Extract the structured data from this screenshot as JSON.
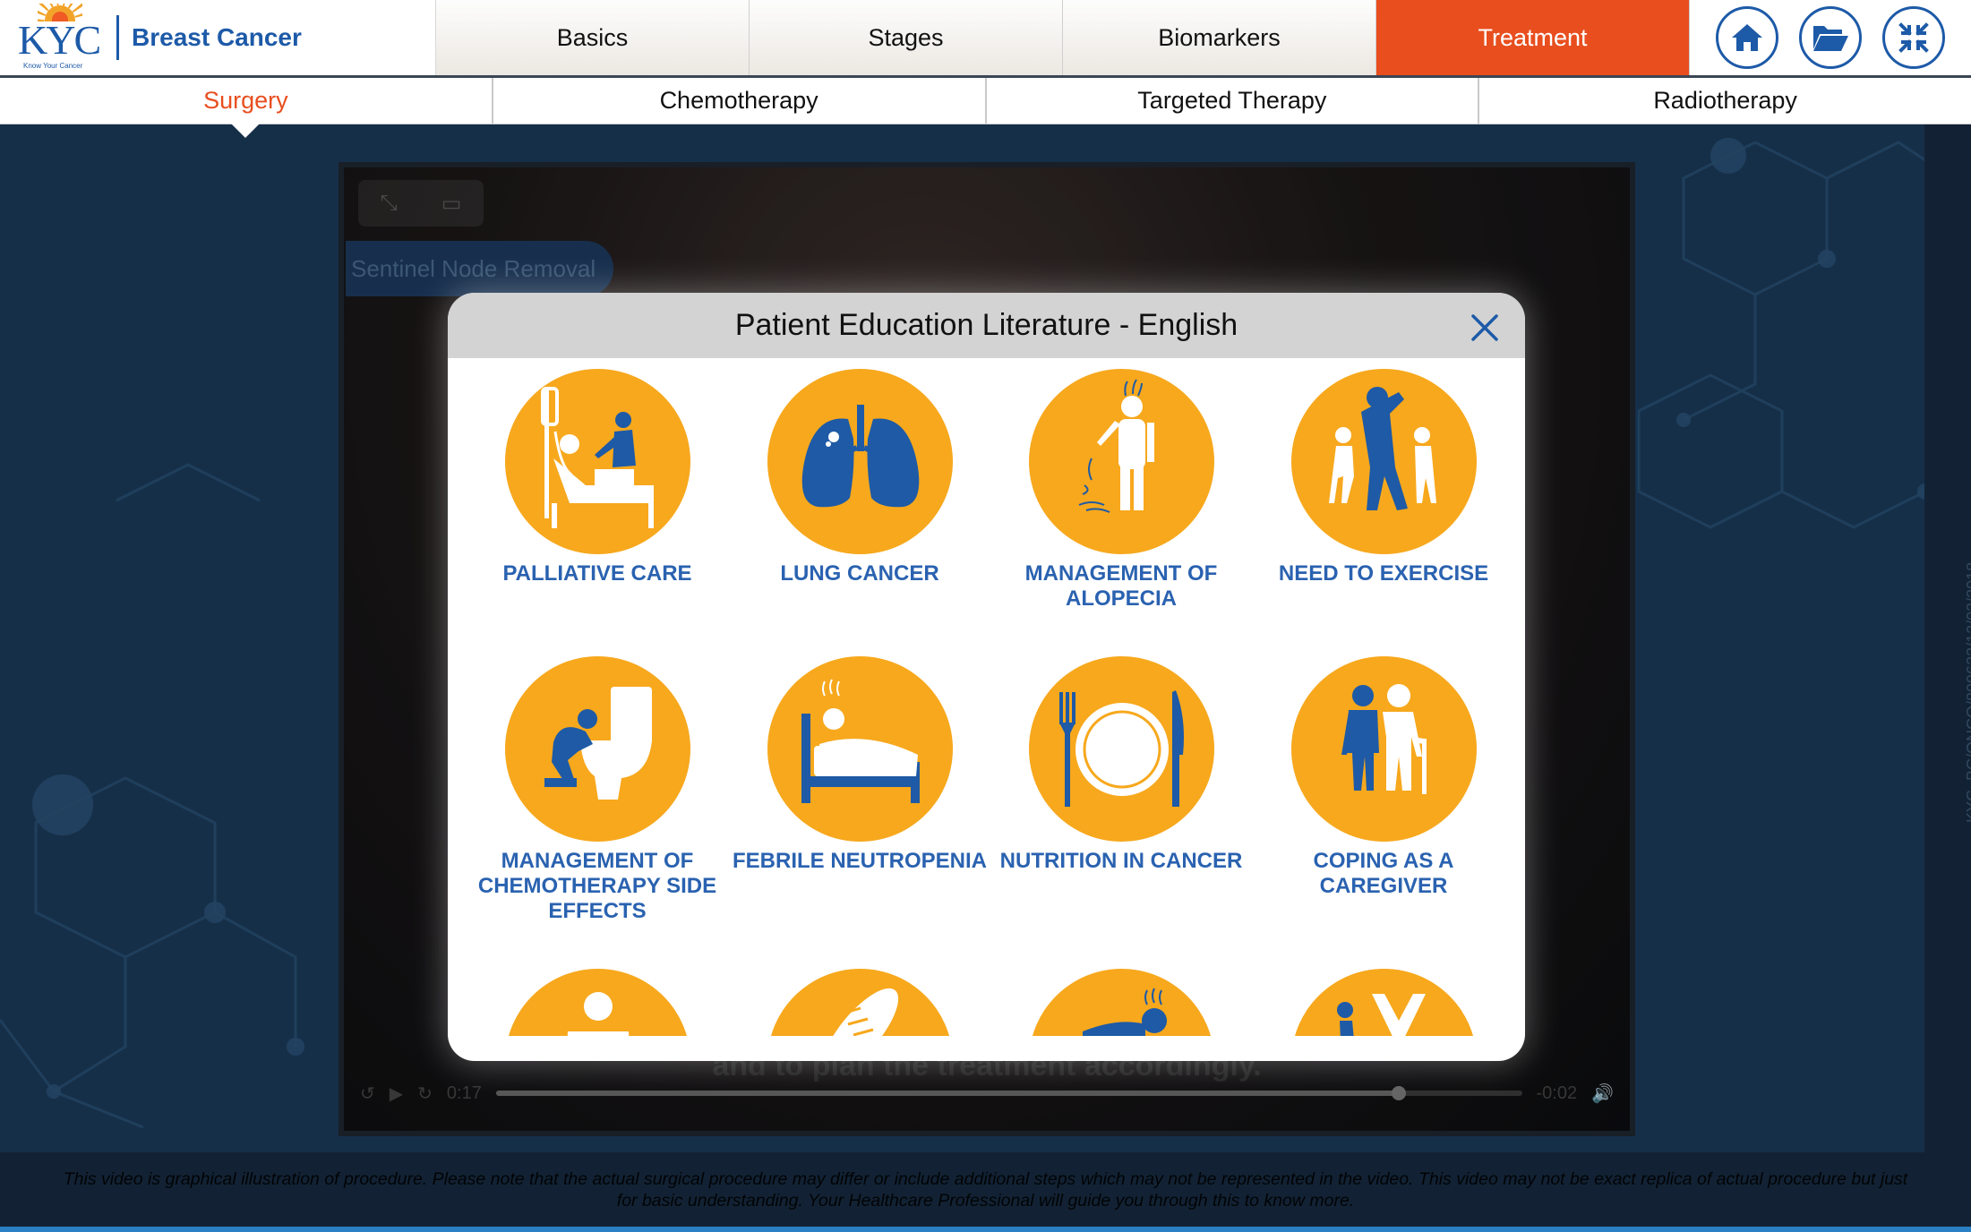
{
  "app": {
    "logo_text": "KYC",
    "logo_tagline": "Know Your Cancer",
    "title": "Breast Cancer"
  },
  "main_tabs": [
    {
      "label": "Basics",
      "active": false
    },
    {
      "label": "Stages",
      "active": false
    },
    {
      "label": "Biomarkers",
      "active": false
    },
    {
      "label": "Treatment",
      "active": true
    }
  ],
  "header_icons": [
    "home-icon",
    "folder-open-icon",
    "collapse-icon"
  ],
  "sub_tabs": [
    {
      "label": "Surgery",
      "active": true
    },
    {
      "label": "Chemotherapy",
      "active": false
    },
    {
      "label": "Targeted Therapy",
      "active": false
    },
    {
      "label": "Radiotherapy",
      "active": false
    }
  ],
  "video": {
    "chapter": "Sentinel Node Removal",
    "elapsed": "0:17",
    "remaining": "-0:02",
    "progress": 0.88,
    "subtitle": "and to plan the treatment accordingly."
  },
  "watermark_code": "KYC_BC/ONCO/809633/12/03/2018",
  "modal": {
    "title": "Patient Education Literature - English",
    "items": [
      {
        "label": "Palliative Care",
        "icon": "palliative-care-icon"
      },
      {
        "label": "Lung Cancer",
        "icon": "lungs-icon"
      },
      {
        "label": "Management of Alopecia",
        "icon": "hair-loss-icon"
      },
      {
        "label": "Need to Exercise",
        "icon": "exercise-icon"
      },
      {
        "label": "Management of Chemotherapy Side Effects",
        "icon": "vomiting-icon"
      },
      {
        "label": "Febrile Neutropenia",
        "icon": "fever-bed-icon"
      },
      {
        "label": "Nutrition in Cancer",
        "icon": "plate-cutlery-icon"
      },
      {
        "label": "Coping as a Caregiver",
        "icon": "caregiver-icon"
      },
      {
        "label": "",
        "icon": "person-pain-icon"
      },
      {
        "label": "",
        "icon": "dna-icon"
      },
      {
        "label": "",
        "icon": "fatigue-icon"
      },
      {
        "label": "",
        "icon": "ribbon-icon"
      }
    ]
  },
  "disclaimer": "This video is graphical illustration of procedure. Please note that the actual surgical procedure may differ or include additional steps which may not be represented in the video. This video may not be exact replica of actual procedure but just for basic understanding. Your Healthcare Professional will guide you through this to know more.",
  "colors": {
    "accent": "#e84e1e",
    "brand_blue": "#1d5aa8",
    "icon_orange": "#f7a81d",
    "label_blue": "#2a62b0"
  }
}
